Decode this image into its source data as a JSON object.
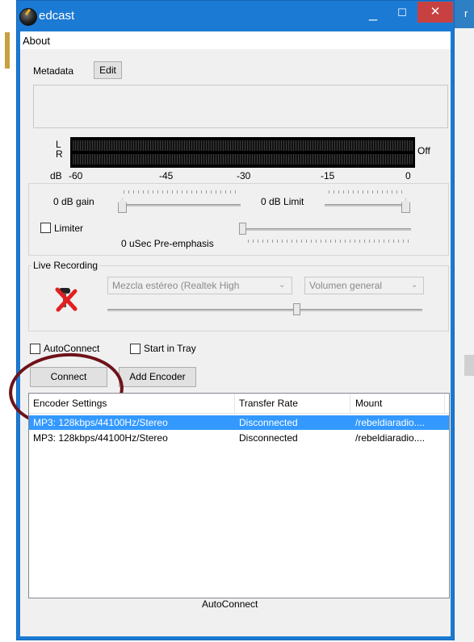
{
  "window": {
    "title": "edcast",
    "min_glyph": "_",
    "max_glyph": "☐",
    "close_glyph": "✕"
  },
  "background": {
    "right_edge_text": "r"
  },
  "menu": {
    "items": [
      "About"
    ]
  },
  "metadata": {
    "label": "Metadata",
    "edit_button": "Edit",
    "value": ""
  },
  "vu_meter": {
    "left_label": "L",
    "right_label": "R",
    "status": "Off",
    "scale": [
      "dB",
      "-60",
      "-45",
      "-30",
      "-15",
      "0"
    ]
  },
  "gain": {
    "label": "0 dB gain",
    "level": 0
  },
  "limit": {
    "label": "0 dB Limit",
    "level": 1
  },
  "limiter": {
    "label": "Limiter",
    "checked": false
  },
  "preemphasis": {
    "label": "0  uSec Pre-emphasis"
  },
  "live_recording": {
    "group_label": "Live Recording",
    "device": "Mezcla estéreo (Realtek High",
    "control": "Volumen general",
    "volume_level": 0.6
  },
  "autoconnect": {
    "label": "AutoConnect",
    "checked": false
  },
  "start_in_tray": {
    "label": "Start in Tray",
    "checked": false
  },
  "buttons": {
    "connect": "Connect",
    "add_encoder": "Add Encoder"
  },
  "encoders": {
    "columns": [
      "Encoder Settings",
      "Transfer Rate",
      "Mount"
    ],
    "rows": [
      {
        "settings": "MP3: 128kbps/44100Hz/Stereo",
        "rate": "Disconnected",
        "mount": "/rebeldiaradio....",
        "selected": true
      },
      {
        "settings": "MP3: 128kbps/44100Hz/Stereo",
        "rate": "Disconnected",
        "mount": "/rebeldiaradio....",
        "selected": false
      }
    ]
  },
  "status_bar": {
    "text": "AutoConnect"
  },
  "colors": {
    "titlebar": "#1b7ad3",
    "close": "#c74141",
    "selection": "#3399ff",
    "annotation": "#6e1219"
  }
}
